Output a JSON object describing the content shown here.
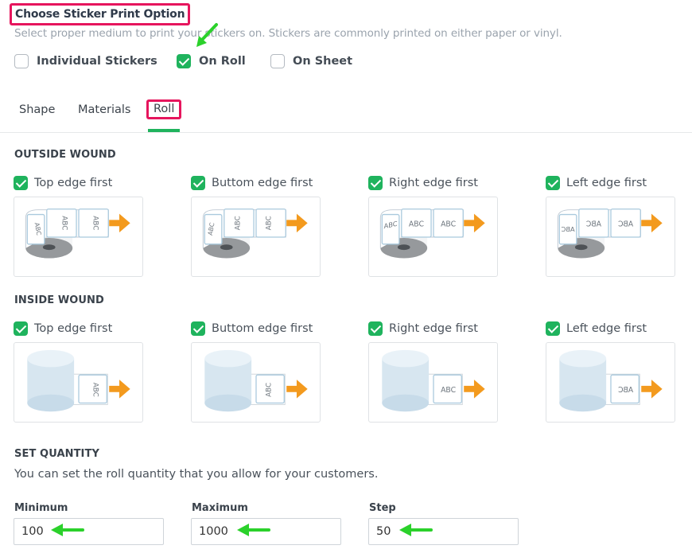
{
  "header": {
    "title": "Choose Sticker Print Option",
    "subtitle": "Select proper medium to print your stickers on. Stickers are commonly printed on either paper or vinyl."
  },
  "print_options": [
    {
      "label": "Individual Stickers",
      "checked": false
    },
    {
      "label": "On Roll",
      "checked": true
    },
    {
      "label": "On Sheet",
      "checked": false
    }
  ],
  "tabs": [
    {
      "label": "Shape",
      "active": false
    },
    {
      "label": "Materials",
      "active": false
    },
    {
      "label": "Roll",
      "active": true
    }
  ],
  "outside_wound": {
    "title": "OUTSIDE WOUND",
    "items": [
      {
        "label": "Top edge first",
        "checked": true,
        "label_text": "ABC"
      },
      {
        "label": "Buttom edge first",
        "checked": true,
        "label_text": "ABC"
      },
      {
        "label": "Right edge first",
        "checked": true,
        "label_text": "ABC"
      },
      {
        "label": "Left edge first",
        "checked": true,
        "label_text": "ABC"
      }
    ]
  },
  "inside_wound": {
    "title": "INSIDE WOUND",
    "items": [
      {
        "label": "Top edge first",
        "checked": true,
        "label_text": "ABC"
      },
      {
        "label": "Buttom edge first",
        "checked": true,
        "label_text": "ABC"
      },
      {
        "label": "Right edge first",
        "checked": true,
        "label_text": "ABC"
      },
      {
        "label": "Left edge first",
        "checked": true,
        "label_text": "ABC"
      }
    ]
  },
  "quantity": {
    "title": "SET QUANTITY",
    "description": "You can set the roll quantity that you allow for your customers.",
    "fields": [
      {
        "label": "Minimum",
        "value": "100"
      },
      {
        "label": "Maximum",
        "value": "1000"
      },
      {
        "label": "Step",
        "value": "50"
      }
    ]
  },
  "colors": {
    "accent_green": "#1fb35d",
    "highlight_pink": "#e6155d",
    "arrow_orange": "#f39a1e",
    "annotation_green": "#2bd12b"
  }
}
